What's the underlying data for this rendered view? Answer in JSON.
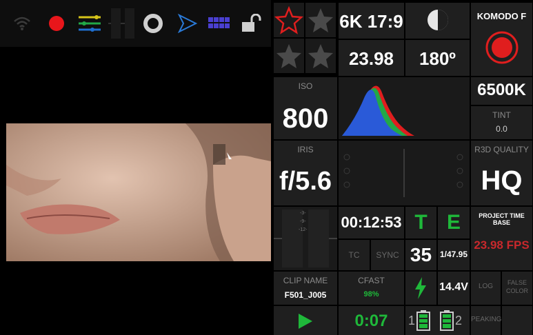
{
  "toolbar": {
    "icons": [
      "wifi-icon",
      "record-dot-icon",
      "layers-icon",
      "meter-icon",
      "circle-icon",
      "play-outline-icon",
      "grid-icon",
      "lock-open-icon"
    ],
    "meter_ticks": [
      "--",
      "--"
    ]
  },
  "stars": {
    "accent": "#e01e1e"
  },
  "format": {
    "resolution": "6K 17:9",
    "fps": "23.98",
    "shutter": "180º"
  },
  "camera": {
    "name": "KOMODO F"
  },
  "iso": {
    "label": "ISO",
    "value": "800"
  },
  "white_balance": {
    "kelvin": "6500K",
    "tint_label": "TINT",
    "tint_value": "0.0"
  },
  "iris": {
    "label": "IRIS",
    "value": "f/5.6"
  },
  "r3d": {
    "label": "R3D QUALITY",
    "value": "HQ"
  },
  "audio": {
    "ticks": [
      "-3-",
      "-9-",
      "-12-"
    ]
  },
  "timecode": {
    "value": "00:12:53",
    "tc_label": "TC",
    "sync_label": "SYNC"
  },
  "indicators": {
    "t": "T",
    "e": "E",
    "shutter_angle_num": "35",
    "shutter_speed": "1/47.95"
  },
  "project": {
    "label": "PROJECT TIME BASE",
    "value": "23.98 FPS"
  },
  "clip": {
    "label": "CLIP NAME",
    "value": "F501_J005"
  },
  "media": {
    "label": "CFAST",
    "value": "98%"
  },
  "power": {
    "voltage": "14.4V",
    "battery1": "1",
    "battery2": "2"
  },
  "modes": {
    "log": "LOG",
    "false_color": "FALSE COLOR",
    "peaking": "PEAKING"
  },
  "transport": {
    "duration": "0:07"
  },
  "colors": {
    "green": "#1fb83a",
    "red": "#e01e1e",
    "accent_red_text": "#c8282c"
  }
}
